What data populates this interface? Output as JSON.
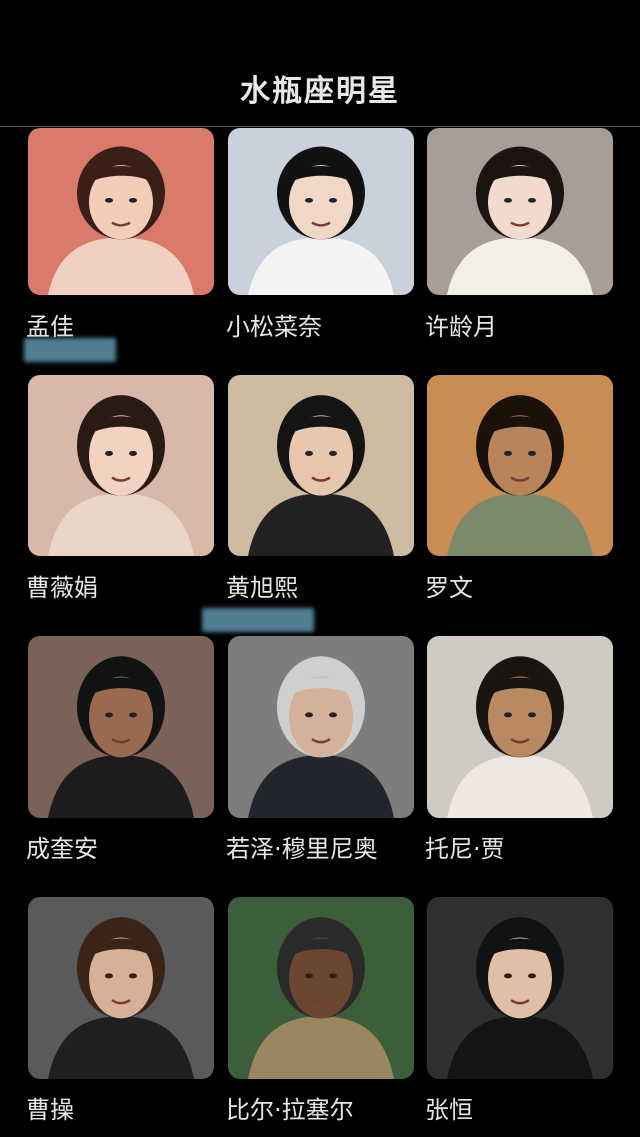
{
  "header": {
    "title": "水瓶座明星"
  },
  "celebrities": [
    {
      "name": "孟佳",
      "bg": "#d97a6a",
      "fg": "#f0d0c0",
      "hair": "#3a1e18",
      "skin": "#f3cdb8"
    },
    {
      "name": "小松菜奈",
      "bg": "#c9d2dc",
      "fg": "#f4f4f4",
      "hair": "#111111",
      "skin": "#f1d7c6"
    },
    {
      "name": "许龄月",
      "bg": "#a79e98",
      "fg": "#f2efe9",
      "hair": "#1c1410",
      "skin": "#f2dbcc"
    },
    {
      "name": "曹薇娟",
      "bg": "#d8b8a8",
      "fg": "#e9d6c9",
      "hair": "#2a1a14",
      "skin": "#f2d2c0"
    },
    {
      "name": "黄旭熙",
      "bg": "#cdbca2",
      "fg": "#222222",
      "hair": "#141414",
      "skin": "#e9c7ad"
    },
    {
      "name": "罗文",
      "bg": "#c98c54",
      "fg": "#7a8a6a",
      "hair": "#1a1208",
      "skin": "#b8855a"
    },
    {
      "name": "成奎安",
      "bg": "#7a6258",
      "fg": "#1c1c1c",
      "hair": "#121212",
      "skin": "#9a6a50"
    },
    {
      "name": "若泽·穆里尼奥",
      "bg": "#7d7d7d",
      "fg": "#23252c",
      "hair": "#cfcfcf",
      "skin": "#d3b19a"
    },
    {
      "name": "托尼·贾",
      "bg": "#cfcac4",
      "fg": "#efe8e2",
      "hair": "#1a1410",
      "skin": "#b98a62"
    },
    {
      "name": "曹操",
      "bg": "#5a5a5a",
      "fg": "#1f1f1f",
      "hair": "#3a2418",
      "skin": "#d6b198"
    },
    {
      "name": "比尔·拉塞尔",
      "bg": "#3d5e3a",
      "fg": "#9a8660",
      "hair": "#2a2a2a",
      "skin": "#6b4630"
    },
    {
      "name": "张恒",
      "bg": "#303030",
      "fg": "#141414",
      "hair": "#121212",
      "skin": "#e0bfa6"
    }
  ]
}
